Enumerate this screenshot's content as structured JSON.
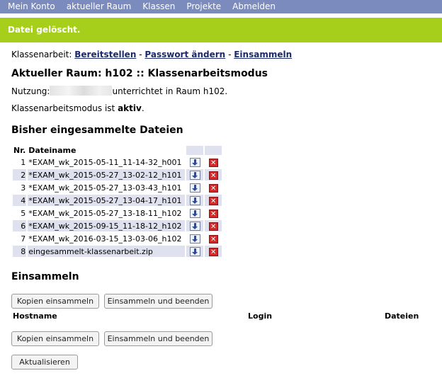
{
  "nav": {
    "items": [
      "Mein Konto",
      "aktueller Raum",
      "Klassen",
      "Projekte",
      "Abmelden"
    ]
  },
  "banner": {
    "message": "Datei gelöscht."
  },
  "actions": {
    "prefix": "Klassenarbeit:",
    "links": [
      "Bereitstellen",
      "Passwort ändern",
      "Einsammeln"
    ],
    "separator": "-"
  },
  "room": {
    "title": "Aktueller Raum: h102 :: Klassenarbeitsmodus",
    "usage_prefix": "Nutzung:",
    "usage_suffix": "unterrichtet in Raum h102.",
    "mode_prefix": "Klassenarbeitsmodus ist",
    "mode_value": "aktiv",
    "mode_suffix": "."
  },
  "collected": {
    "heading": "Bisher eingesammelte Dateien",
    "col_nr": "Nr.",
    "col_name": "Dateiname",
    "files": [
      {
        "nr": "1",
        "name": "*EXAM_wk_2015-05-11_11-14-32_h001"
      },
      {
        "nr": "2",
        "name": "*EXAM_wk_2015-05-27_13-02-12_h101"
      },
      {
        "nr": "3",
        "name": "*EXAM_wk_2015-05-27_13-03-43_h101"
      },
      {
        "nr": "4",
        "name": "*EXAM_wk_2015-05-27_13-04-17_h101"
      },
      {
        "nr": "5",
        "name": "*EXAM_wk_2015-05-27_13-18-11_h102"
      },
      {
        "nr": "6",
        "name": "*EXAM_wk_2015-09-15_11-18-12_h102"
      },
      {
        "nr": "7",
        "name": "*EXAM_wk_2016-03-15_13-03-06_h102"
      },
      {
        "nr": "8",
        "name": "eingesammelt-klassenarbeit.zip"
      }
    ]
  },
  "collect": {
    "heading": "Einsammeln",
    "btn_copies": "Kopien einsammeln",
    "btn_collect_end": "Einsammeln und beenden",
    "col_hostname": "Hostname",
    "col_login": "Login",
    "col_files": "Dateien",
    "btn_refresh": "Aktualisieren"
  },
  "icons": {
    "download": "download-icon",
    "delete": "delete-icon"
  },
  "colors": {
    "nav": "#7b8bbd",
    "banner": "#a5cf1a",
    "link": "#1a2a6c",
    "row_alt": "#dfe2ee"
  }
}
